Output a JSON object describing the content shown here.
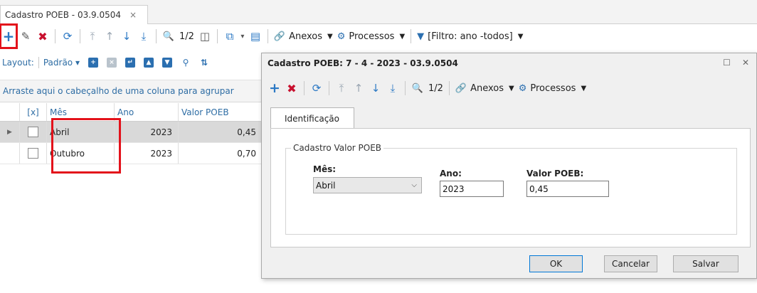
{
  "tab": {
    "title": "Cadastro POEB - 03.9.0504",
    "close": "×"
  },
  "main_toolbar": {
    "add": "+",
    "edit": "✎",
    "delete": "✖",
    "refresh": "⟳",
    "first": "⤒",
    "prev": "↑",
    "next": "↓",
    "last": "⤓",
    "search": "🔍",
    "page": "1/2",
    "layout_toggle": "◫",
    "export": "⧉",
    "export_caret": "▾",
    "doc": "▤",
    "anexos": "Anexos",
    "processos": "Processos",
    "filter": "[Filtro: ano -todos]"
  },
  "layout_bar": {
    "label": "Layout:",
    "value": "Padrão"
  },
  "group_hint": "Arraste aqui o cabeçalho de uma coluna para agrupar",
  "grid": {
    "columns": [
      "[x]",
      "Mês",
      "Ano",
      "Valor POEB"
    ],
    "rows": [
      {
        "mes": "Abril",
        "ano": "2023",
        "valor": "0,45"
      },
      {
        "mes": "Outubro",
        "ano": "2023",
        "valor": "0,70"
      }
    ]
  },
  "dialog": {
    "title": "Cadastro POEB: 7 - 4 - 2023 - 03.9.0504",
    "page": "1/2",
    "anexos": "Anexos",
    "processos": "Processos",
    "tab": "Identificação",
    "group": "Cadastro Valor POEB",
    "mes_label": "Mês:",
    "mes_value": "Abril",
    "ano_label": "Ano:",
    "ano_value": "2023",
    "valor_label": "Valor POEB:",
    "valor_value": "0,45",
    "ok": "OK",
    "cancel": "Cancelar",
    "save": "Salvar"
  },
  "colors": {
    "accent": "#2b78c4",
    "delete": "#c8102e",
    "highlight": "#e3121b"
  }
}
